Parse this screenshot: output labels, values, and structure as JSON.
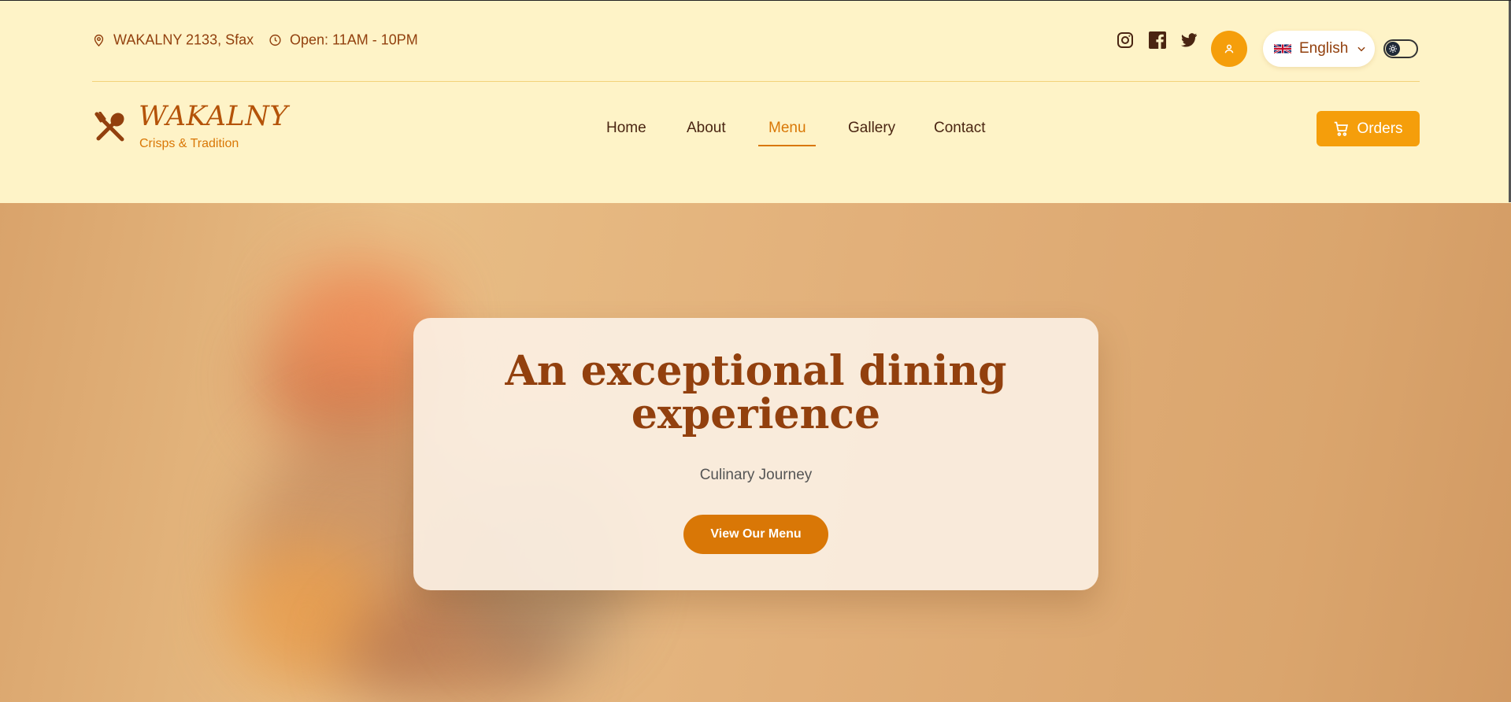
{
  "topbar": {
    "address": "WAKALNY 2133, Sfax",
    "hours": "Open: 11AM - 10PM",
    "address_icon": "map-pin-icon",
    "hours_icon": "clock-icon",
    "social_icons": [
      "instagram-icon",
      "facebook-icon",
      "twitter-icon"
    ],
    "language": "English",
    "language_flag": "uk-flag-icon"
  },
  "brand": {
    "name": "WAKALNY",
    "tagline": "Crisps & Tradition"
  },
  "nav": {
    "items": [
      "Home",
      "About",
      "Menu",
      "Gallery",
      "Contact"
    ],
    "active": "Menu"
  },
  "orders_label": "Orders",
  "hero": {
    "title": "An exceptional dining experience",
    "subtitle": "Culinary Journey",
    "cta_label": "View Our Menu"
  },
  "colors": {
    "accent": "#f59e0b",
    "brand_brown": "#92400e",
    "background": "#fef3c7"
  }
}
